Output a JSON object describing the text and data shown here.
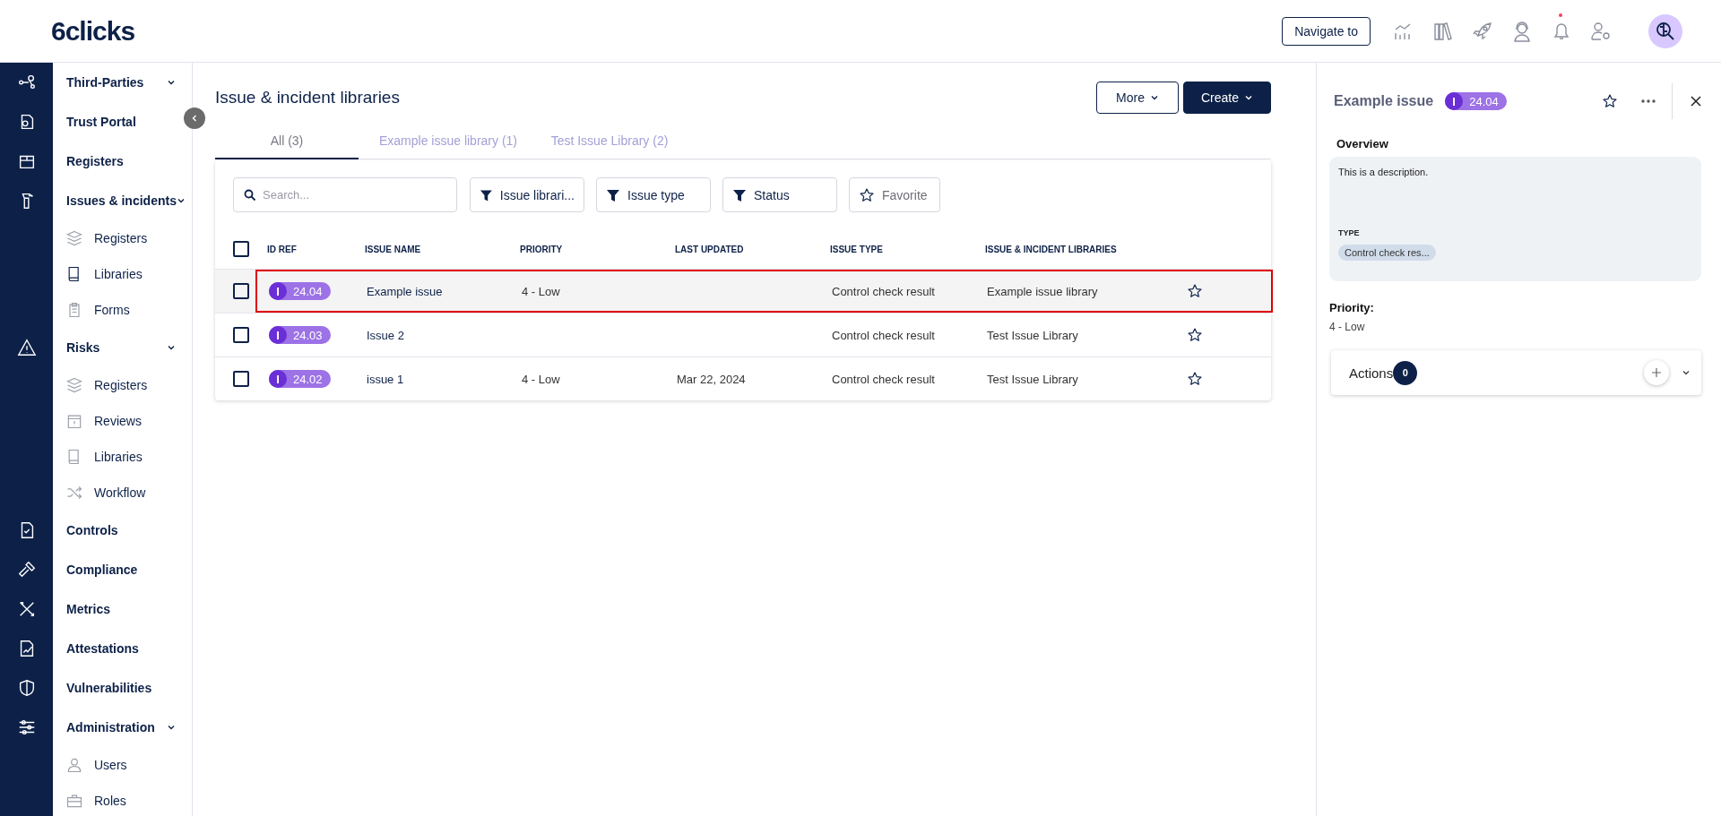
{
  "header": {
    "logo": "6clicks",
    "navigate_button": "Navigate to",
    "notification_unread": true
  },
  "nav": [
    {
      "label": "Third-Parties",
      "expandable": true
    },
    {
      "label": "Trust Portal",
      "expandable": false
    },
    {
      "label": "Registers",
      "expandable": false
    },
    {
      "label": "Issues & incidents",
      "expandable": true,
      "children": [
        {
          "label": "Registers"
        },
        {
          "label": "Libraries"
        },
        {
          "label": "Forms"
        }
      ]
    },
    {
      "label": "Risks",
      "expandable": true,
      "children": [
        {
          "label": "Registers"
        },
        {
          "label": "Reviews"
        },
        {
          "label": "Libraries"
        },
        {
          "label": "Workflow"
        }
      ]
    },
    {
      "label": "Controls",
      "expandable": false
    },
    {
      "label": "Compliance",
      "expandable": false
    },
    {
      "label": "Metrics",
      "expandable": false
    },
    {
      "label": "Attestations",
      "expandable": false
    },
    {
      "label": "Vulnerabilities",
      "expandable": false
    },
    {
      "label": "Administration",
      "expandable": true,
      "children": [
        {
          "label": "Users"
        },
        {
          "label": "Roles"
        }
      ]
    }
  ],
  "page": {
    "title": "Issue & incident libraries",
    "buttons": [
      {
        "label": "More",
        "kind": "secondary"
      },
      {
        "label": "Create",
        "kind": "primary"
      }
    ],
    "tabs": [
      {
        "label": "All (3)",
        "selected": true
      },
      {
        "label": "Example issue library (1)",
        "selected": false
      },
      {
        "label": "Test Issue Library (2)",
        "selected": false
      }
    ],
    "search": {
      "placeholder": "Search..."
    },
    "filters": [
      {
        "label": "Issue librari...",
        "kind": "filter"
      },
      {
        "label": "Issue type",
        "kind": "filter"
      },
      {
        "label": "Status",
        "kind": "filter"
      },
      {
        "label": "Favorite",
        "kind": "favorite"
      }
    ],
    "table": {
      "select_all_checked": false,
      "columns": [
        "ID REF",
        "ISSUE NAME",
        "PRIORITY",
        "LAST UPDATED",
        "ISSUE TYPE",
        "ISSUE & INCIDENT LIBRARIES"
      ],
      "rows": [
        {
          "checked": false,
          "selected": true,
          "id_prefix": "I",
          "id_number": "24.04",
          "name": "Example issue",
          "priority": "4 - Low",
          "last_updated": "",
          "issue_type": "Control check result",
          "library": "Example issue library",
          "favorite": false
        },
        {
          "checked": false,
          "selected": false,
          "id_prefix": "I",
          "id_number": "24.03",
          "name": "Issue 2",
          "priority": "",
          "last_updated": "",
          "issue_type": "Control check result",
          "library": "Test Issue Library",
          "favorite": false
        },
        {
          "checked": false,
          "selected": false,
          "id_prefix": "I",
          "id_number": "24.02",
          "name": "issue 1",
          "priority": "4 - Low",
          "last_updated": "Mar 22, 2024",
          "issue_type": "Control check result",
          "library": "Test Issue Library",
          "favorite": false
        }
      ]
    }
  },
  "detail": {
    "title": "Example issue",
    "id_prefix": "I",
    "id_number": "24.04",
    "favorite": false,
    "overview_label": "Overview",
    "description": "This is a description.",
    "type_label": "TYPE",
    "type_value": "Control check res...",
    "priority_label": "Priority:",
    "priority_value": "4 - Low",
    "actions_label": "Actions",
    "actions_count": "0"
  }
}
